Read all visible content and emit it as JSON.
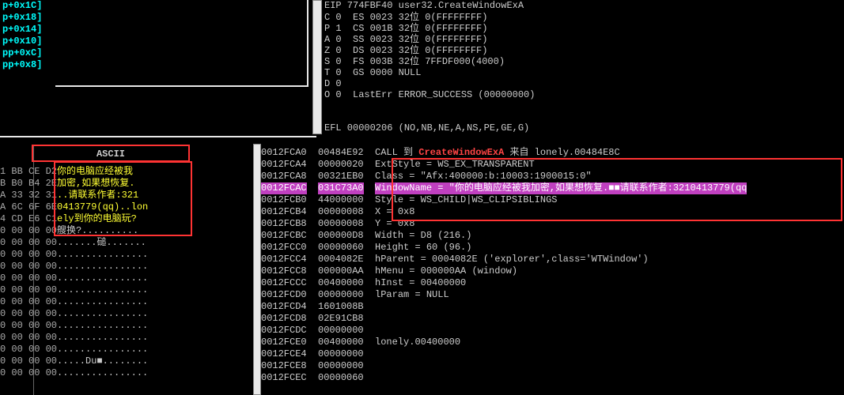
{
  "breakpoints": [
    "p+0x1C]",
    "p+0x18]",
    "p+0x14]",
    "p+0x10]",
    "pp+0xC]",
    "pp+0x8]"
  ],
  "eip": "EIP 774FBF40 user32.CreateWindowExA",
  "flags": [
    "C 0  ES 0023 32位 0(FFFFFFFF)",
    "P 1  CS 001B 32位 0(FFFFFFFF)",
    "A 0  SS 0023 32位 0(FFFFFFFF)",
    "Z 0  DS 0023 32位 0(FFFFFFFF)",
    "S 0  FS 003B 32位 7FFDF000(4000)",
    "T 0  GS 0000 NULL",
    "D 0",
    "O 0  LastErr ERROR_SUCCESS (00000000)"
  ],
  "efl": "EFL 00000206 (NO,NB,NE,A,NS,PE,GE,G)",
  "ascii_header": "ASCII",
  "hex_lines": [
    "1 BB CE D2",
    "B B0 B4 2E",
    "A 33 32 31",
    "A 6C 6F 6E",
    "4 CD E6 C1",
    "0 00 00 00",
    "",
    "0 00 00 00",
    "0 00 00 00",
    "0 00 00 00",
    "0 00 00 00",
    "0 00 00 00",
    "0 00 00 00",
    "0 00 00 00",
    "0 00 00 00",
    "0 00 00 00",
    "0 00 00 00",
    "0 00 00 00",
    "0 00 00 00"
  ],
  "ascii_lines": [
    "你的电脑应经被我",
    "加密,如果想恢复.",
    "..请联系作者:321",
    "0413779(qq)..lon",
    "ely到你的电脑玩?",
    "艘换?..........",
    "",
    ".......磓.......",
    "................",
    "................",
    "................",
    "................",
    "................",
    "................",
    "................",
    "................",
    "................",
    ".....Du■........",
    "................"
  ],
  "stack": [
    {
      "a": "0012FCA0",
      "v": "00484E92",
      "d": "CALL 到 ",
      "d2": "CreateWindowExA",
      "d3": " 来自 lonely.00484E8C",
      "red": true
    },
    {
      "a": "0012FCA4",
      "v": "00000020",
      "d": "ExtStyle = WS_EX_TRANSPARENT"
    },
    {
      "a": "0012FCA8",
      "v": "00321EB0",
      "d": "Class = \"Afx:400000:b:10003:1900015:0\""
    },
    {
      "a": "0012FCAC",
      "v": "031C73A0",
      "d": "WindowName = \"你的电脑应经被我加密,如果想恢复.■■请联系作者:3210413779(qq",
      "hl": true
    },
    {
      "a": "0012FCB0",
      "v": "44000000",
      "d": "Style = WS_CHILD|WS_CLIPSIBLINGS"
    },
    {
      "a": "0012FCB4",
      "v": "00000008",
      "d": "X = 0x8"
    },
    {
      "a": "0012FCB8",
      "v": "00000008",
      "d": "Y = 0x8"
    },
    {
      "a": "0012FCBC",
      "v": "000000D8",
      "d": "Width = D8 (216.)"
    },
    {
      "a": "0012FCC0",
      "v": "00000060",
      "d": "Height = 60 (96.)"
    },
    {
      "a": "0012FCC4",
      "v": "0004082E",
      "d": "hParent = 0004082E ('explorer',class='WTWindow')"
    },
    {
      "a": "0012FCC8",
      "v": "000000AA",
      "d": "hMenu = 000000AA (window)"
    },
    {
      "a": "0012FCCC",
      "v": "00400000",
      "d": "hInst = 00400000"
    },
    {
      "a": "0012FCD0",
      "v": "00000000",
      "d": "lParam = NULL"
    },
    {
      "a": "0012FCD4",
      "v": "1601008B",
      "d": ""
    },
    {
      "a": "0012FCD8",
      "v": "02E91CB8",
      "d": ""
    },
    {
      "a": "0012FCDC",
      "v": "00000000",
      "d": ""
    },
    {
      "a": "0012FCE0",
      "v": "00400000",
      "d": "lonely.00400000"
    },
    {
      "a": "0012FCE4",
      "v": "00000000",
      "d": ""
    },
    {
      "a": "0012FCE8",
      "v": "00000000",
      "d": ""
    },
    {
      "a": "0012FCEC",
      "v": "00000060",
      "d": ""
    }
  ]
}
